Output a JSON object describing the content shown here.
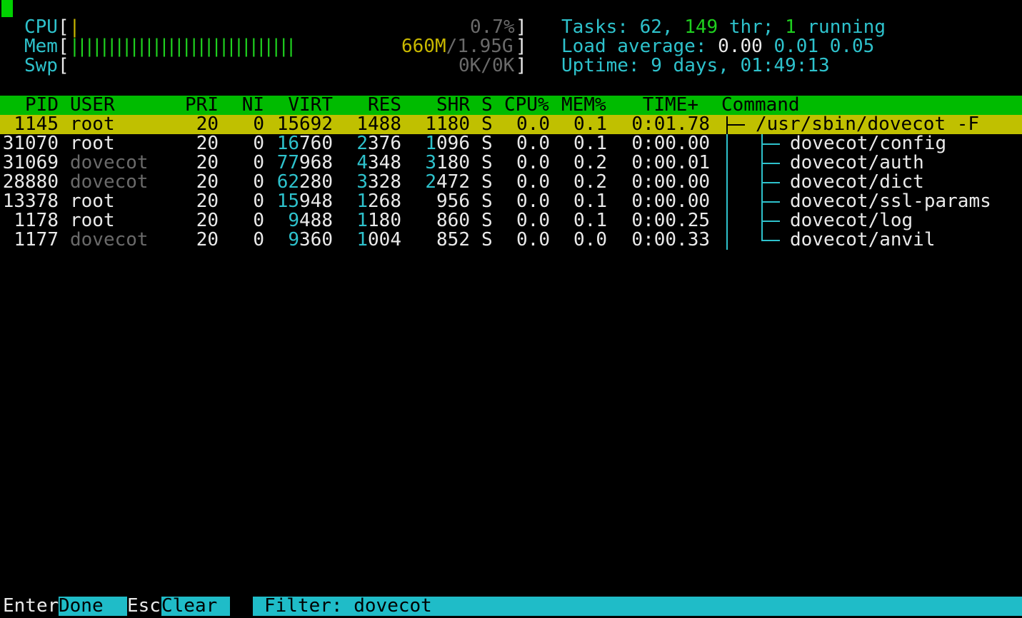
{
  "meters": {
    "cpu": {
      "label": "CPU",
      "bars": "|",
      "value": "0.7%"
    },
    "mem": {
      "label": "Mem",
      "bars": "||||||||||||||||||||||||||||||",
      "used": "660M",
      "slash": "/",
      "total": "1.95G"
    },
    "swp": {
      "label": "Swp",
      "value": "0K/0K"
    },
    "open": "[",
    "close": "]"
  },
  "stats": {
    "tasks_label": "Tasks: ",
    "tasks": "62",
    "sep1": ", ",
    "threads": "149",
    "thr_label": " thr; ",
    "running": "1",
    "running_label": " running",
    "load_label": "Load average: ",
    "load1": "0.00",
    "load5": "0.01",
    "load15": "0.05",
    "uptime_label": "Uptime: ",
    "uptime": "9 days, 01:49:13"
  },
  "columns": {
    "pid": "PID",
    "user": "USER",
    "pri": "PRI",
    "ni": "NI",
    "virt": "VIRT",
    "res": "RES",
    "shr": "SHR",
    "s": "S",
    "cpu": "CPU%",
    "mem": "MEM%",
    "time": "TIME+",
    "command": "Command"
  },
  "processes": [
    {
      "pid": "1145",
      "user": "root",
      "pri": "20",
      "ni": "0",
      "virt": "15692",
      "res": "1488",
      "shr": "1180",
      "s": "S",
      "cpu": "0.0",
      "mem": "0.1",
      "time": "0:01.78",
      "command": "/usr/sbin/dovecot -F"
    },
    {
      "pid": "31070",
      "user": "root",
      "pri": "20",
      "ni": "0",
      "virt_hi": "16",
      "virt_lo": "760",
      "res_hi": "2",
      "res_lo": "376",
      "shr_hi": "1",
      "shr_lo": "096",
      "s": "S",
      "cpu": "0.0",
      "mem": "0.1",
      "time": "0:00.00",
      "command": "dovecot/config"
    },
    {
      "pid": "31069",
      "user": "dovecot",
      "pri": "20",
      "ni": "0",
      "virt_hi": "77",
      "virt_lo": "968",
      "res_hi": "4",
      "res_lo": "348",
      "shr_hi": "3",
      "shr_lo": "180",
      "s": "S",
      "cpu": "0.0",
      "mem": "0.2",
      "time": "0:00.01",
      "command": "dovecot/auth"
    },
    {
      "pid": "28880",
      "user": "dovecot",
      "pri": "20",
      "ni": "0",
      "virt_hi": "62",
      "virt_lo": "280",
      "res_hi": "3",
      "res_lo": "328",
      "shr_hi": "2",
      "shr_lo": "472",
      "s": "S",
      "cpu": "0.0",
      "mem": "0.2",
      "time": "0:00.00",
      "command": "dovecot/dict"
    },
    {
      "pid": "13378",
      "user": "root",
      "pri": "20",
      "ni": "0",
      "virt_hi": "15",
      "virt_lo": "948",
      "res_hi": "1",
      "res_lo": "268",
      "shr_hi": "",
      "shr_lo": "956",
      "s": "S",
      "cpu": "0.0",
      "mem": "0.1",
      "time": "0:00.00",
      "command": "dovecot/ssl-params"
    },
    {
      "pid": "1178",
      "user": "root",
      "pri": "20",
      "ni": "0",
      "virt_hi": "9",
      "virt_lo": "488",
      "res_hi": "1",
      "res_lo": "180",
      "shr_hi": "",
      "shr_lo": "860",
      "s": "S",
      "cpu": "0.0",
      "mem": "0.1",
      "time": "0:00.25",
      "command": "dovecot/log"
    },
    {
      "pid": "1177",
      "user": "dovecot",
      "pri": "20",
      "ni": "0",
      "virt_hi": "9",
      "virt_lo": "360",
      "res_hi": "1",
      "res_lo": "004",
      "shr_hi": "",
      "shr_lo": "852",
      "s": "S",
      "cpu": "0.0",
      "mem": "0.0",
      "time": "0:00.33",
      "command": "dovecot/anvil"
    }
  ],
  "footer": {
    "enter_key": "Enter",
    "enter_label": "Done",
    "esc_key": "Esc",
    "esc_label": "Clear",
    "filter_label": "Filter: ",
    "filter_value": "dovecot"
  },
  "colors": {
    "header_bg": "#00bb00",
    "selected_bg": "#c0c000",
    "footer_bg": "#1fbcc8",
    "accent_cyan": "#2ec2cc"
  }
}
